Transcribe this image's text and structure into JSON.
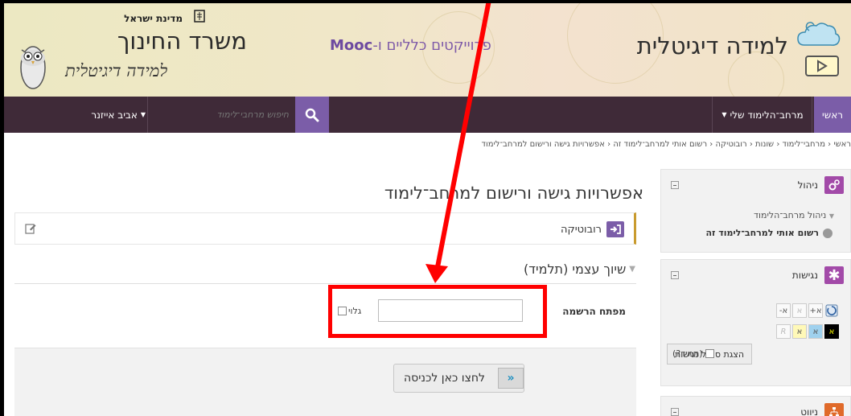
{
  "header": {
    "brand_title": "למידה דיגיטלית",
    "project_link_prefix": "פרוייקטים כלליים ו-",
    "project_link_bold": "Mooc",
    "ministry_state": "מדינת ישראל",
    "ministry_name": "משרד החינוך",
    "ministry_sub": "למידה דיגיטלית"
  },
  "nav": {
    "home": "ראשי",
    "my_space": "מרחב־הלימוד שלי",
    "search_placeholder": "חיפוש מרחבי־לימוד",
    "user": "אביב אייזנר"
  },
  "breadcrumb": "ראשי ‹ מרחבי־לימוד ‹ שונות ‹ רובוטיקה ‹ רשום אותי למרחב־לימוד זה ‹ אפשרויות גישה ורישום למרחב־לימוד",
  "main": {
    "page_title": "אפשרויות גישה ורישום למרחב־לימוד",
    "course_name": "רובוטיקה",
    "section_title": "שיוך עצמי (תלמיד)",
    "key_label": "מפתח הרשמה",
    "key_value": "",
    "reveal_label": "גלוי",
    "login_button": "לחצו כאן לכניסה"
  },
  "sidebar": {
    "admin": {
      "title": "ניהול",
      "sub": "ניהול מרחב־הלימוד",
      "item": "רשום אותי למרחב־לימוד זה",
      "icon_color": "#a24aa8"
    },
    "accessibility": {
      "title": "נגישות",
      "row1": [
        "א-",
        "א",
        "א+"
      ],
      "row2": [
        "R",
        "א",
        "א",
        "א"
      ],
      "button": "הצגת סרגל נגישות",
      "always": "(תמיד?)",
      "icon_color": "#a24aa8"
    },
    "third": {
      "title": "ניווט",
      "icon_color": "#e06a2a"
    }
  },
  "colors": {
    "accent": "#7b5da8",
    "navbar": "#3f2a38",
    "annotation": "#ff0000"
  }
}
